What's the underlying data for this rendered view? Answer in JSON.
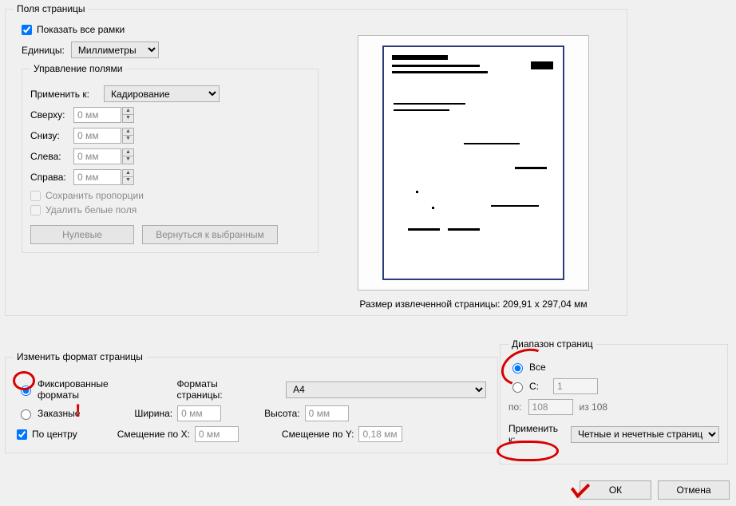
{
  "margins_group": {
    "title": "Поля страницы",
    "show_all_frames": "Показать все рамки",
    "units_label": "Единицы:",
    "units_value": "Миллиметры",
    "manage_title": "Управление полями",
    "apply_to_label": "Применить к:",
    "apply_to_value": "Кадирование",
    "top_label": "Сверху:",
    "bottom_label": "Снизу:",
    "left_label": "Слева:",
    "right_label": "Справа:",
    "zero_mm": "0 мм",
    "keep_proportions": "Сохранить пропорции",
    "remove_white": "Удалить белые поля",
    "btn_zero": "Нулевые",
    "btn_revert": "Вернуться к выбранным",
    "extracted_size": "Размер извлеченной страницы: 209,91 x 297,04 мм"
  },
  "resize_group": {
    "title": "Изменить формат страницы",
    "fixed_formats": "Фиксированные форматы",
    "custom": "Заказные",
    "formats_label": "Форматы страницы:",
    "formats_value": "A4",
    "width_label": "Ширина:",
    "height_label": "Высота:",
    "zero_mm": "0 мм",
    "center": "По центру",
    "offset_x_label": "Смещение по X:",
    "offset_x_value": "0 мм",
    "offset_y_label": "Смещение по Y:",
    "offset_y_value": "0,18 мм"
  },
  "range_group": {
    "title": "Диапазон страниц",
    "all": "Все",
    "from_label": "С:",
    "from_value": "1",
    "to_label": "по:",
    "to_value": "108",
    "of_text": "из 108",
    "apply_to_label": "Применить к:",
    "apply_to_value": "Четные и нечетные страницы"
  },
  "buttons": {
    "ok": "ОК",
    "cancel": "Отмена"
  }
}
